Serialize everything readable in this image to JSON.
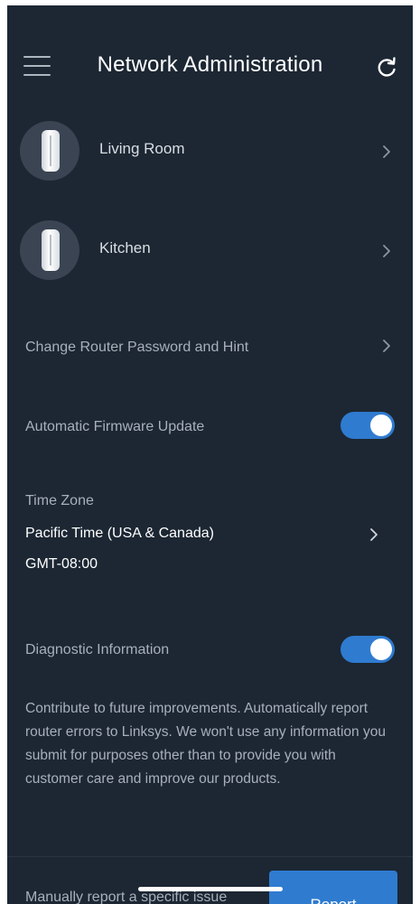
{
  "header": {
    "title": "Network Administration",
    "menu_icon": "hamburger-menu-icon",
    "refresh_icon": "refresh-icon"
  },
  "nodes": [
    {
      "label": "Living Room",
      "icon": "router-node-icon"
    },
    {
      "label": "Kitchen",
      "icon": "router-node-icon"
    }
  ],
  "settings": {
    "change_password_label": "Change Router Password and Hint",
    "firmware_label": "Automatic Firmware Update",
    "firmware_enabled": true,
    "timezone_label": "Time Zone",
    "timezone_value": "Pacific Time (USA & Canada)",
    "timezone_offset": "GMT-08:00",
    "diagnostic_label": "Diagnostic Information",
    "diagnostic_enabled": true,
    "diagnostic_description": "Contribute to future improvements. Automatically report router errors to Linksys. We won't use any information you submit for purposes other than to provide you with customer care and improve our products.",
    "manual_report_label": "Manually report a specific issue",
    "report_button_label": "Report"
  },
  "colors": {
    "background": "#1c2733",
    "accent": "#2f7bd0",
    "muted_text": "#a8b0ba"
  }
}
